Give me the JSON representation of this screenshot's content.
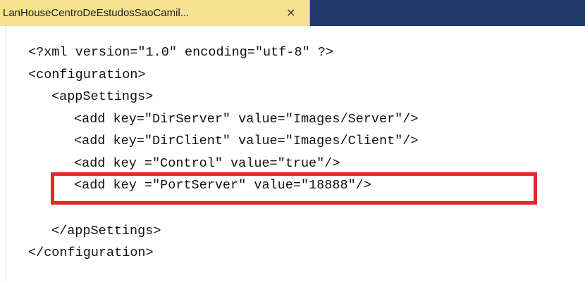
{
  "tab": {
    "title": "LanHouseCentroDeEstudosSaoCamil...",
    "close_glyph": "×"
  },
  "editor": {
    "lines": [
      "<?xml version=\"1.0\" encoding=\"utf-8\" ?>",
      "<configuration>",
      "<appSettings>",
      "<add key=\"DirServer\" value=\"Images/Server\"/>",
      "<add key=\"DirClient\" value=\"Images/Client\"/>",
      "<add key =\"Control\" value=\"true\"/>",
      "<add key =\"PortServer\" value=\"18888\"/>",
      "</appSettings>",
      "</configuration>"
    ]
  },
  "colors": {
    "tab_active": "#f5e28f",
    "tab_strip": "#1f3a6b",
    "highlight": "#e02a2a"
  }
}
